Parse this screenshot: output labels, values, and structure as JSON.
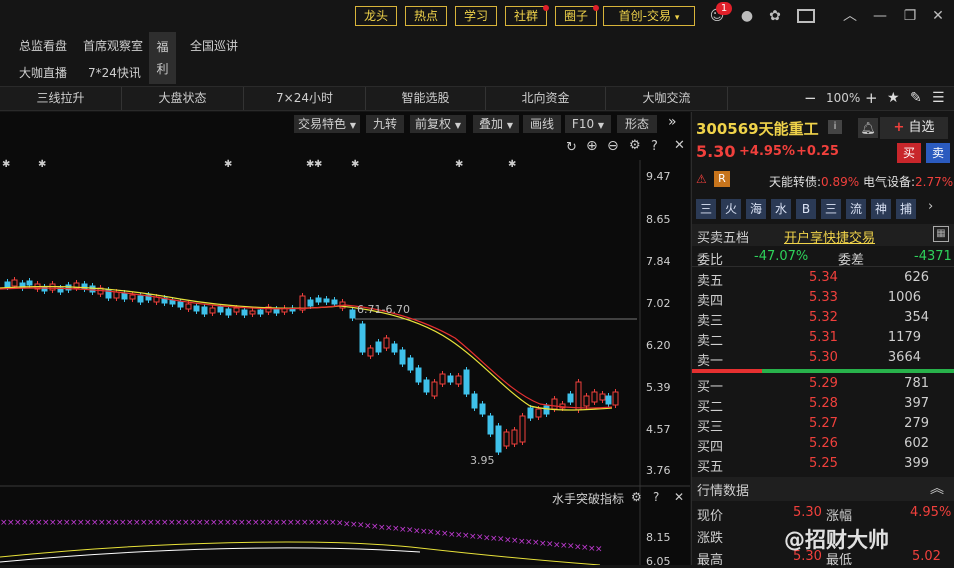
{
  "topbar": {
    "tabs": [
      "龙头",
      "热点",
      "学习",
      "社群",
      "圈子",
      "首创-交易"
    ],
    "badge": "1"
  },
  "nav": {
    "row1": [
      "总监看盘",
      "首席观察室",
      "全国巡讲"
    ],
    "row2": [
      "大咖直播",
      "7*24快讯"
    ],
    "fuli": "福\n利"
  },
  "tabs": [
    "三线拉升",
    "大盘状态",
    "7×24小时",
    "智能选股",
    "北向资金",
    "大咖交流"
  ],
  "zoom": "100%",
  "chart": {
    "toolbar": [
      "交易特色",
      "九转",
      "前复权",
      "叠加",
      "画线",
      "F10",
      "形态"
    ],
    "price_axis": [
      "9.47",
      "8.65",
      "7.84",
      "7.02",
      "6.20",
      "5.39",
      "4.57",
      "3.76"
    ],
    "annot_hi": "6.71-6.70",
    "annot_lo": "3.95",
    "sub_indicator": "水手突破指标",
    "sub_axis": [
      "8.15",
      "6.05"
    ]
  },
  "stock": {
    "code": "300569",
    "name": "天能重工",
    "info": "i",
    "watch": "自选",
    "price": "5.30",
    "pct": "+4.95%",
    "chg": "+0.25",
    "buy": "买",
    "sell": "卖",
    "tag": "R",
    "rel1_name": "天能转债:",
    "rel1_val": "0.89%",
    "rel2_name": "电气设备:",
    "rel2_val": "2.77%",
    "flags": [
      "三",
      "火",
      "海",
      "水",
      "B",
      "三",
      "流",
      "神",
      "捕"
    ],
    "depth_title": "买卖五档",
    "quick": "开户享快捷交易",
    "weibi_label": "委比",
    "weibi": "-47.07%",
    "weicha_label": "委差",
    "weicha": "-4371",
    "asks": [
      {
        "l": "卖五",
        "p": "5.34",
        "v": "626"
      },
      {
        "l": "卖四",
        "p": "5.33",
        "v": "1006"
      },
      {
        "l": "卖三",
        "p": "5.32",
        "v": "354"
      },
      {
        "l": "卖二",
        "p": "5.31",
        "v": "1179"
      },
      {
        "l": "卖一",
        "p": "5.30",
        "v": "3664"
      }
    ],
    "bids": [
      {
        "l": "买一",
        "p": "5.29",
        "v": "781"
      },
      {
        "l": "买二",
        "p": "5.28",
        "v": "397"
      },
      {
        "l": "买三",
        "p": "5.27",
        "v": "279"
      },
      {
        "l": "买四",
        "p": "5.26",
        "v": "602"
      },
      {
        "l": "买五",
        "p": "5.25",
        "v": "399"
      }
    ],
    "quote_title": "行情数据",
    "q": {
      "xj": "现价",
      "xj_v": "5.30",
      "zf": "涨幅",
      "zf_v": "4.95%",
      "zd": "涨跌",
      "zg": "最高",
      "zg_v": "5.30",
      "zd2": "最低",
      "zd2_v": "5.02"
    },
    "watermark": "@招财大帅"
  },
  "colors": {
    "up": "#f0403c",
    "down": "#2ed15a",
    "gold": "#d8b43a"
  }
}
